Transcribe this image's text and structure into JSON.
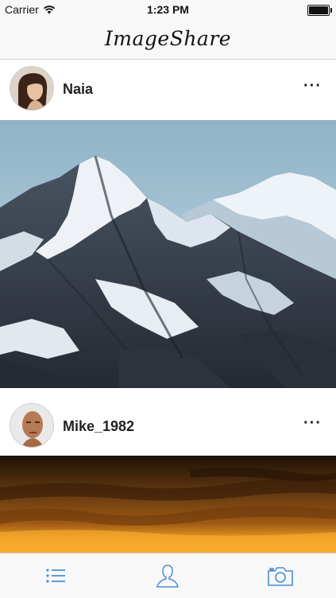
{
  "status_bar": {
    "carrier": "Carrier",
    "time": "1:23 PM",
    "battery_level": 1.0,
    "icons": [
      "wifi-icon",
      "battery-icon"
    ]
  },
  "nav": {
    "title": "ImageShare"
  },
  "feed": {
    "posts": [
      {
        "username": "Naia",
        "avatar": "avatar-photo",
        "image": "snowy-mountain-peaks-photo",
        "more_label": "···"
      },
      {
        "username": "Mike_1982",
        "avatar": "avatar-photo",
        "image": "sunset-sky-photo",
        "more_label": "···"
      }
    ]
  },
  "tab_bar": {
    "tabs": [
      {
        "icon": "list-icon"
      },
      {
        "icon": "profile-icon"
      },
      {
        "icon": "camera-icon"
      }
    ]
  },
  "colors": {
    "bar_background": "#f8f8f8",
    "separator": "#cfcfcf",
    "tab_icon": "#4a8fd1"
  }
}
